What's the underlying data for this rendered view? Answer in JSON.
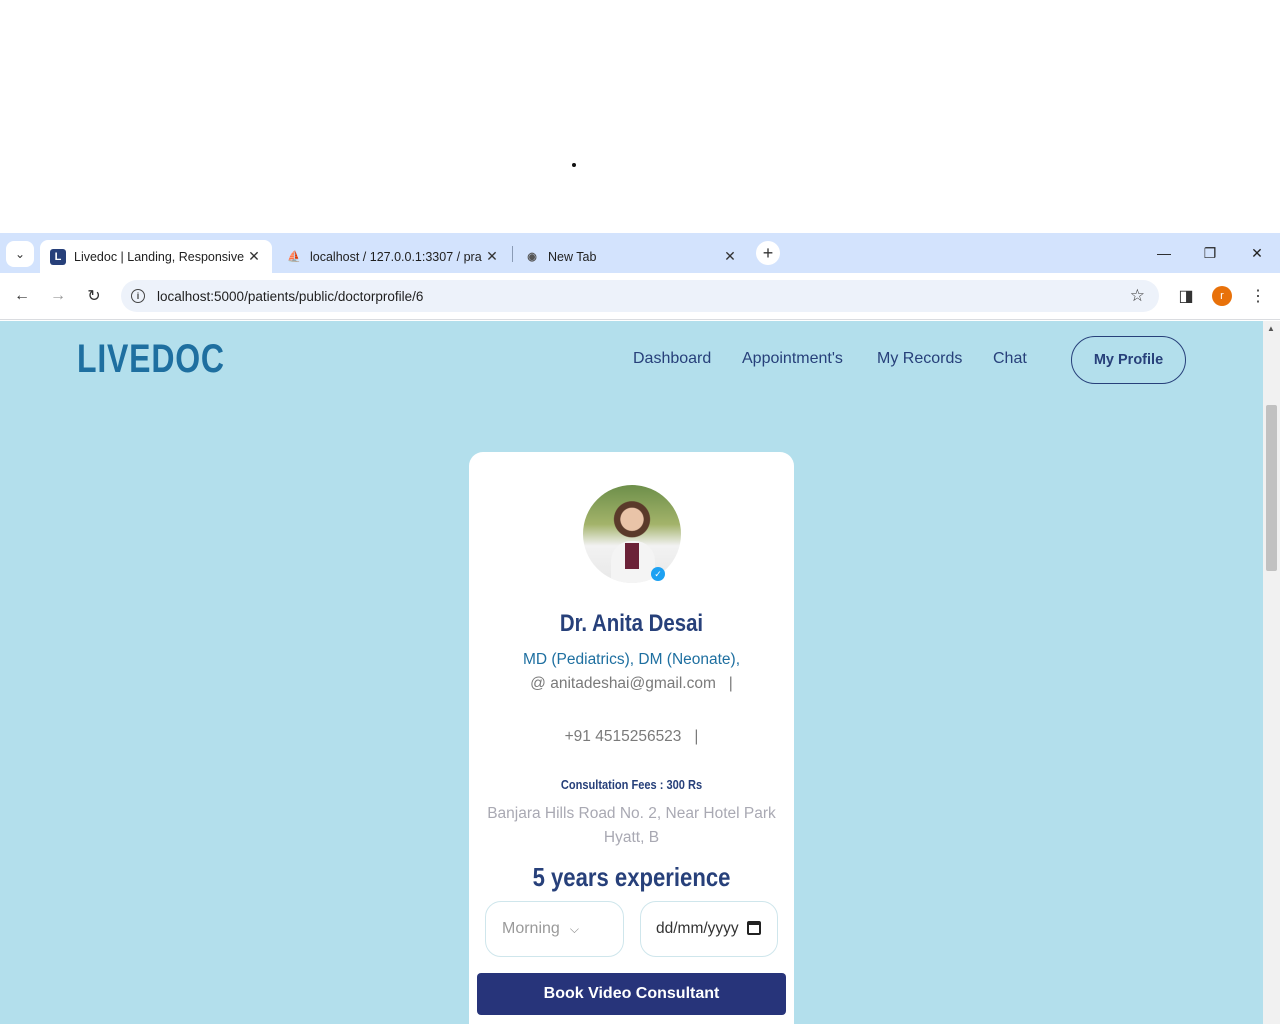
{
  "browser": {
    "tabs": [
      {
        "title": "Livedoc | Landing, Responsive",
        "favicon": "L"
      },
      {
        "title": "localhost / 127.0.0.1:3307 / pra",
        "favicon": "pma-icon"
      },
      {
        "title": "New Tab",
        "favicon": "chrome-icon"
      }
    ],
    "url": "localhost:5000/patients/public/doctorprofile/6",
    "profile_initial": "r"
  },
  "header": {
    "logo": "LIVEDOC",
    "nav": [
      "Dashboard",
      "Appointment's",
      "My Records",
      "Chat"
    ],
    "profile_button": "My Profile"
  },
  "doctor": {
    "name": "Dr. Anita Desai",
    "qualifications": "MD (Pediatrics), DM (Neonate),",
    "email": "@ anitadeshai@gmail.com   |",
    "phone": "+91 4515256523   |",
    "fees": "Consultation Fees : 300 Rs",
    "address": "Banjara Hills Road No. 2, Near Hotel Park Hyatt, B",
    "experience": "5 years experience"
  },
  "booking": {
    "slot_selected": "Morning",
    "date_placeholder": "dd/mm/yyyy",
    "book_button": "Book Video Consultant"
  },
  "colors": {
    "page_bg": "#b3dfec",
    "primary": "#27407a",
    "accent": "#1e6fa0",
    "button_bg": "#27347a"
  }
}
